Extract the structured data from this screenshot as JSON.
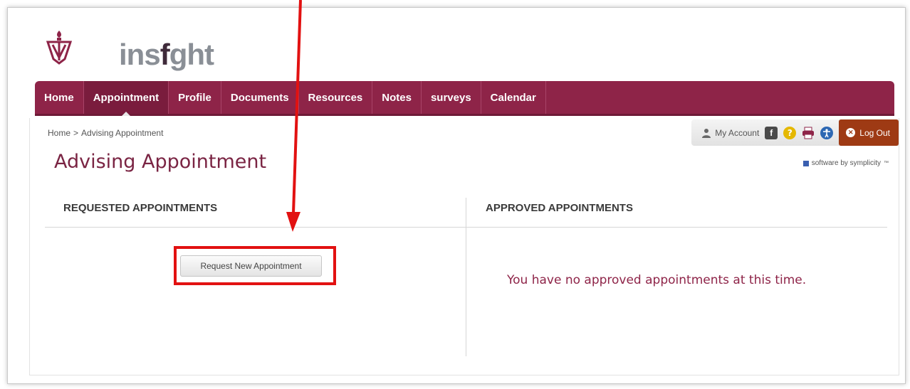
{
  "brand": {
    "name_part1": "ins",
    "name_part2": "ght"
  },
  "nav": {
    "items": [
      {
        "label": "Home"
      },
      {
        "label": "Appointment"
      },
      {
        "label": "Profile"
      },
      {
        "label": "Documents"
      },
      {
        "label": "Resources"
      },
      {
        "label": "Notes"
      },
      {
        "label": "surveys"
      },
      {
        "label": "Calendar"
      }
    ],
    "active_index": 1
  },
  "breadcrumb": {
    "home": "Home",
    "separator": ">",
    "current": "Advising Appointment"
  },
  "utility": {
    "my_account": "My Account",
    "logout": "Log Out"
  },
  "page": {
    "title": "Advising Appointment",
    "vendor": "software by symplicity"
  },
  "requested": {
    "heading": "REQUESTED APPOINTMENTS",
    "button_label": "Request New Appointment"
  },
  "approved": {
    "heading": "APPROVED APPOINTMENTS",
    "empty_message": "You have no approved appointments at this time."
  },
  "colors": {
    "brand": "#8e2448",
    "title": "#7a2443",
    "annotation": "#e21111",
    "logout": "#9e3a14"
  }
}
